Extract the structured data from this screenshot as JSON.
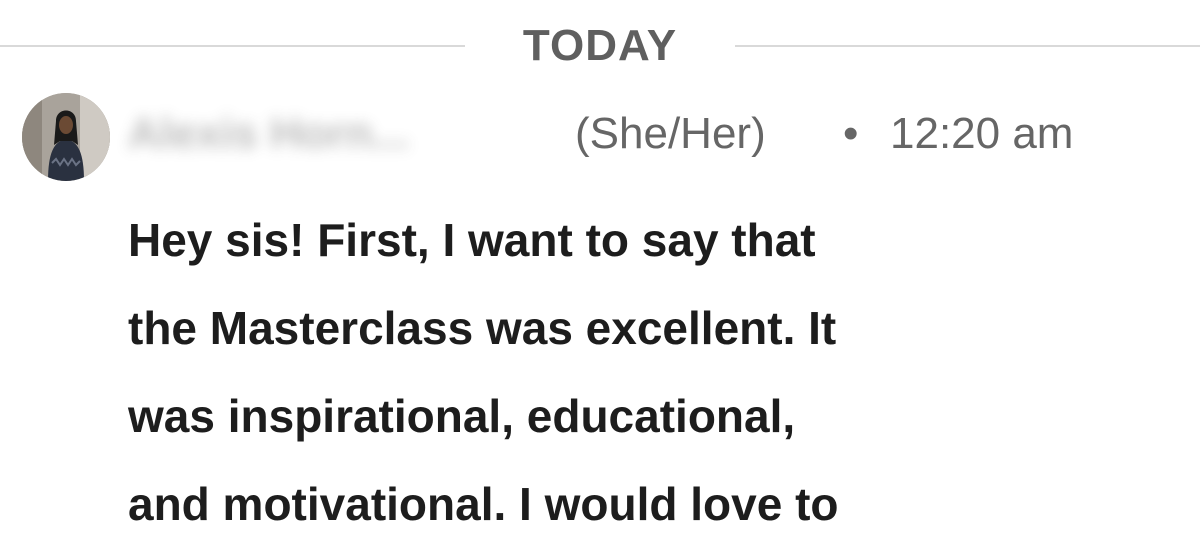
{
  "divider": {
    "label": "TODAY"
  },
  "message": {
    "sender_name": "Alexis Horn...",
    "pronouns": "(She/Her)",
    "separator": "•",
    "timestamp": "12:20 am",
    "lines": [
      "Hey sis! First, I want to say that",
      "the Masterclass was excellent. It",
      "was inspirational, educational,",
      "and motivational. I would love to"
    ]
  },
  "avatar": {
    "icon": "profile-photo",
    "colors": {
      "background": "#a9a39b",
      "clothing": "#2a3140",
      "hair": "#1a1a1a",
      "skin": "#6b4a34"
    }
  }
}
